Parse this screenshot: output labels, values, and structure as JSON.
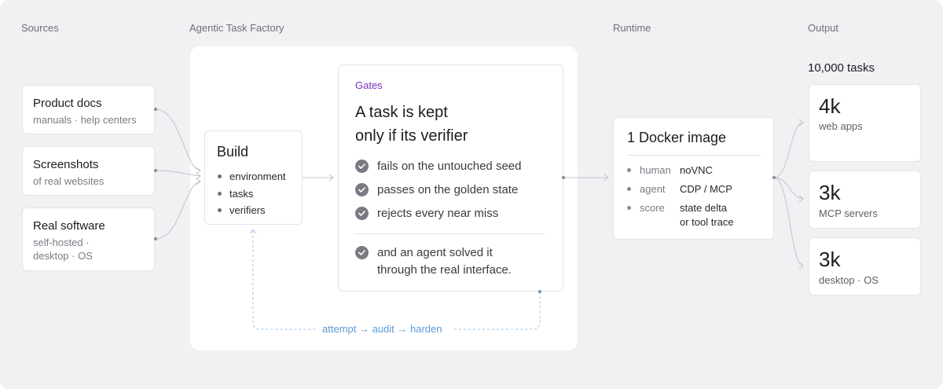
{
  "columns": {
    "sources": "Sources",
    "factory": "Agentic Task Factory",
    "runtime": "Runtime",
    "output": "Output"
  },
  "sources": [
    {
      "title": "Product docs",
      "sub": "manuals · help centers"
    },
    {
      "title": "Screenshots",
      "sub": "of real websites"
    },
    {
      "title": "Real software",
      "sub_line1": "self-hosted ·",
      "sub_line2": "desktop · OS"
    }
  ],
  "build": {
    "title": "Build",
    "items": [
      "environment",
      "tasks",
      "verifiers"
    ]
  },
  "gates": {
    "label": "Gates",
    "headline_line1": "A task is kept",
    "headline_line2": "only if its verifier",
    "checks": [
      "fails on the untouched seed",
      "passes on the golden state",
      "rejects every near miss"
    ],
    "final_check_line1": "and an agent solved it",
    "final_check_line2": "through the real interface."
  },
  "loop": {
    "label": "attempt → audit → harden"
  },
  "runtime": {
    "title": "1 Docker image",
    "rows": [
      {
        "key": "human",
        "value_line1": "noVNC",
        "value_line2": ""
      },
      {
        "key": "agent",
        "value_line1": "CDP / MCP",
        "value_line2": ""
      },
      {
        "key": "score",
        "value_line1": "state delta",
        "value_line2": "or tool trace"
      }
    ]
  },
  "output": {
    "total": "10,000 tasks",
    "cards": [
      {
        "num": "4k",
        "sub": "web apps"
      },
      {
        "num": "3k",
        "sub": "MCP servers"
      },
      {
        "num": "3k",
        "sub": "desktop · OS"
      }
    ]
  },
  "colors": {
    "gates_label": "#7b2fbf",
    "loop": "#5b9bd5",
    "check": "#7a7a84",
    "background": "#f1f1f4"
  },
  "icons": {
    "check": "check-circle-icon",
    "bullet": "bullet-dot-icon",
    "connector": "connector-dot-icon"
  }
}
